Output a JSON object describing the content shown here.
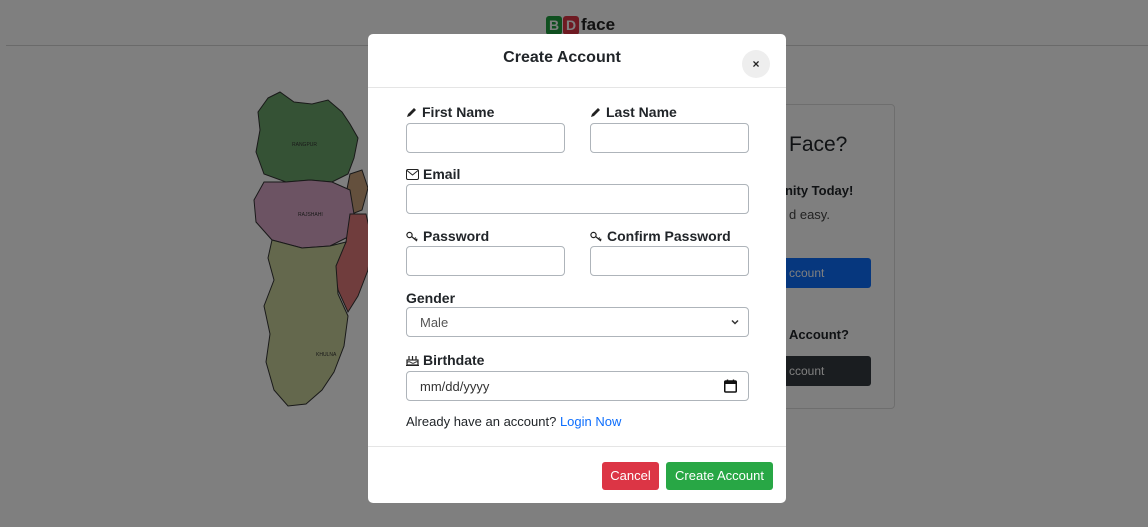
{
  "brand": {
    "letter_b": "B",
    "letter_d": "D",
    "word": "face"
  },
  "map": {
    "regions": [
      "RANGPUR",
      "RAJSHAHI",
      "KHULNA"
    ]
  },
  "card": {
    "title": "Face?",
    "subtitle": "unity Today!",
    "body": "d easy.",
    "primary_button": "ccount",
    "question": "Account?",
    "secondary_button": "ccount"
  },
  "modal": {
    "title": "Create Account",
    "close_label": "×",
    "first_name_label": "First Name",
    "last_name_label": "Last Name",
    "email_label": "Email",
    "password_label": "Password",
    "confirm_password_label": "Confirm Password",
    "gender_label": "Gender",
    "gender_selected": "Male",
    "birthdate_label": "Birthdate",
    "birthdate_placeholder": "mm/dd/yyyy",
    "already_text": "Already have an account?",
    "login_link": "Login Now",
    "cancel_button": "Cancel",
    "create_button": "Create Account"
  },
  "icons": {
    "first_name": "pencil-icon",
    "last_name": "pencil-icon",
    "email": "envelope-icon",
    "password": "key-icon",
    "confirm_password": "key-icon",
    "birthdate": "cake-icon",
    "gender_chevron": "chevron-down-icon",
    "calendar": "calendar-icon"
  },
  "colors": {
    "backdrop": "#808080",
    "cancel": "#dc3545",
    "create": "#28a745",
    "link": "#0d6efd",
    "brand_b": "#1f9e3e",
    "brand_d": "#dc3545"
  }
}
